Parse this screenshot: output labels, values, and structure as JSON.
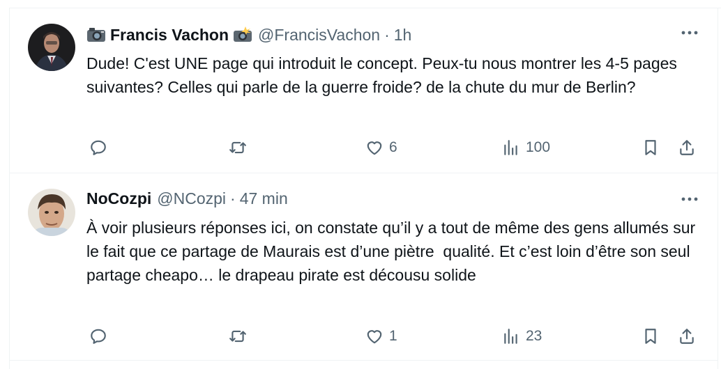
{
  "tweets": [
    {
      "name": "Francis Vachon",
      "handle": "@FrancisVachon",
      "separator": "·",
      "time": "1h",
      "text": "Dude! C'est UNE page qui introduit le concept. Peux-tu nous montrer les 4-5 pages suivantes? Celles qui parle de la guerre froide? de la chute du mur de Berlin?",
      "replies": "",
      "retweets": "",
      "likes": "6",
      "views": "100",
      "icons": {
        "before_name": "camera-emoji-icon",
        "after_name": "camera-flash-emoji-icon"
      }
    },
    {
      "name": "NoCozpi",
      "handle": "@NCozpi",
      "separator": "·",
      "time": "47 min",
      "text": "À voir plusieurs réponses ici, on constate qu’il y a tout de même des gens allumés sur le fait que ce partage de Maurais est d’une piètre  qualité. Et c’est loin d’être son seul partage cheapo… le drapeau pirate est décousu solide",
      "replies": "",
      "retweets": "",
      "likes": "1",
      "views": "23"
    }
  ],
  "colors": {
    "text": "#0f1419",
    "secondary": "#536471",
    "border": "#eff3f4"
  }
}
